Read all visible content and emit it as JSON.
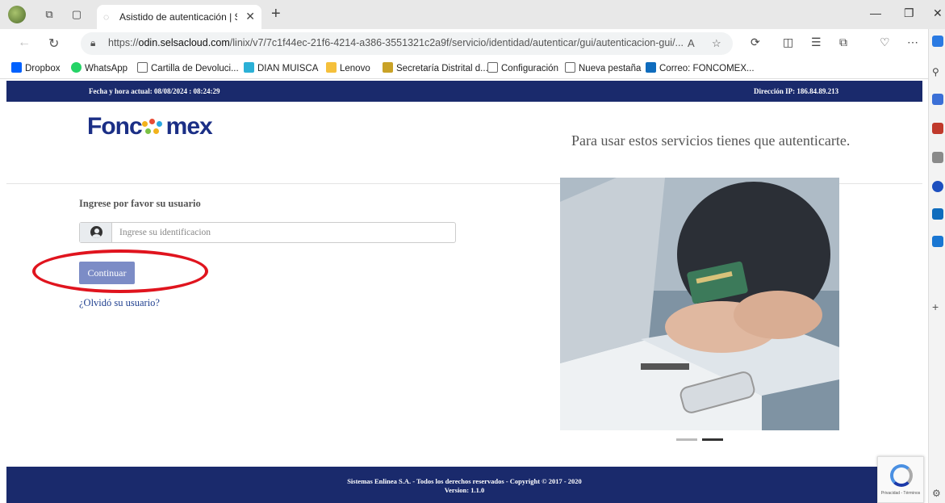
{
  "browser": {
    "tab_title": "Asistido de autenticación | Sisten",
    "url_prefix": "https://",
    "url_domain": "odin.selsacloud.com",
    "url_path": "/linix/v7/7c1f44ec-21f6-4214-a386-3551321c2a9f/servicio/identidad/autenticar/gui/autenticacion-gui/...",
    "bookmarks": [
      "Dropbox",
      "WhatsApp",
      "Cartilla de Devoluci...",
      "DIAN MUISCA",
      "Lenovo",
      "Secretaría Distrital d...",
      "Configuración",
      "Nueva pestaña",
      "Correo: FONCOMEX..."
    ]
  },
  "page": {
    "datetime": "Fecha y hora actual: 08/08/2024 : 08:24:29",
    "ip": "Dirección IP: 186.84.89.213",
    "logo_text_left": "Fonc",
    "logo_text_right": "mex",
    "tagline": "Para usar estos servicios tienes que autenticarte.",
    "prompt": "Ingrese por favor su usuario",
    "input_placeholder": "Ingrese su identificacion",
    "input_value": "",
    "continue_label": "Continuar",
    "forgot_label": "¿Olvidó su usuario?",
    "footer_line1": "Sistemas Enlinea S.A. - Todos los derechos reservados - Copyright © 2017 - 2020",
    "footer_line2": "Version: 1.1.0",
    "recaptcha_text": "Privacidad - Términos"
  },
  "colors": {
    "navy": "#1a2a6c",
    "button": "#7c8cc6",
    "highlight": "#e0141e",
    "link": "#1f3f8f"
  }
}
